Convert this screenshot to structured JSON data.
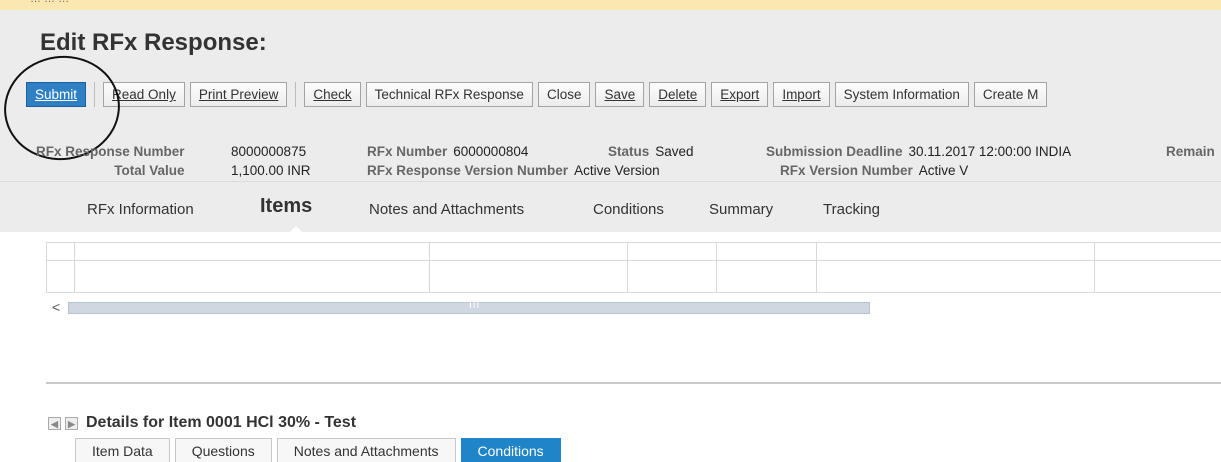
{
  "window": {
    "top_text": "… … …"
  },
  "page_title": "Edit RFx Response:",
  "toolbar": {
    "submit": "Submit",
    "read_only": "Read Only",
    "print_preview": "Print Preview",
    "check": "Check",
    "technical": "Technical RFx Response",
    "close": "Close",
    "save": "Save",
    "delete": "Delete",
    "export": "Export",
    "import": "Import",
    "system_information": "System Information",
    "create": "Create M"
  },
  "summary": {
    "response_number_label": "RFx Response Number",
    "response_number": "8000000875",
    "total_value_label": "Total Value",
    "total_value": "1,100.00 INR",
    "rfx_number_label": "RFx Number",
    "rfx_number": "6000000804",
    "response_version_label": "RFx Response Version Number",
    "response_version": "Active Version",
    "status_label": "Status",
    "status": "Saved",
    "deadline_label": "Submission Deadline",
    "deadline": "30.11.2017 12:00:00 INDIA",
    "rfx_version_label": "RFx Version Number",
    "rfx_version": "Active V",
    "remaining_label": "Remain"
  },
  "tabs": {
    "rfx_information": "RFx Information",
    "items": "Items",
    "notes": "Notes and Attachments",
    "conditions": "Conditions",
    "summary": "Summary",
    "tracking": "Tracking"
  },
  "scroll": {
    "left_arrow": "<",
    "grip": "III"
  },
  "details": {
    "prev": "◀",
    "next": "▶",
    "title": "Details for Item 0001 HCl 30% - Test",
    "tabs": {
      "item_data": "Item Data",
      "questions": "Questions",
      "notes": "Notes and Attachments",
      "conditions": "Conditions"
    }
  }
}
